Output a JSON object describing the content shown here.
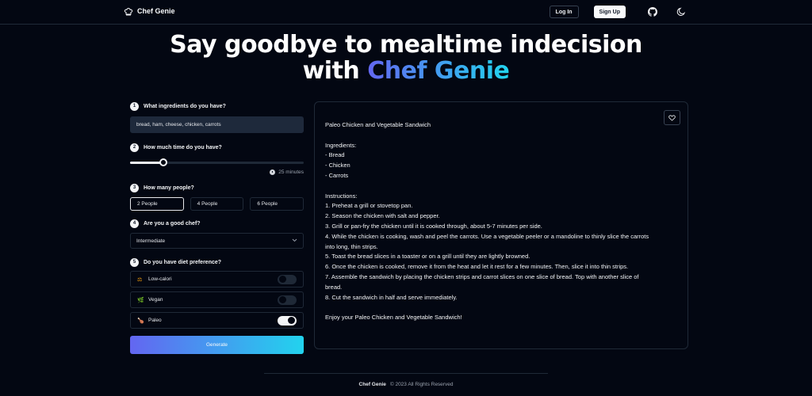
{
  "header": {
    "brand": "Chef Genie",
    "login_label": "Log In",
    "signup_label": "Sign Up",
    "icons": [
      "chef-hat-icon",
      "github-icon",
      "moon-icon"
    ]
  },
  "hero": {
    "line1": "Say goodbye to mealtime indecision",
    "line2_prefix": "with ",
    "line2_highlight": "Chef Genie"
  },
  "form": {
    "steps": [
      {
        "num": "1",
        "label": "What ingredients do you have?"
      },
      {
        "num": "2",
        "label": "How much time do you have?"
      },
      {
        "num": "3",
        "label": "How many people?"
      },
      {
        "num": "4",
        "label": "Are you a good chef?"
      },
      {
        "num": "5",
        "label": "Do you have diet preference?"
      }
    ],
    "ingredients_value": "bread, ham, cheese, chicken, carrots",
    "time_fraction": 0.19,
    "time_label": "25 minutes",
    "people_options": [
      "2 People",
      "4 People",
      "6 People"
    ],
    "people_selected": "2 People",
    "chef_level": "Intermediate",
    "diets": [
      {
        "emoji": "⚖",
        "label": "Low-calori",
        "on": false
      },
      {
        "emoji": "🌿",
        "label": "Vegan",
        "on": false
      },
      {
        "emoji": "🍗",
        "label": "Paleo",
        "on": true
      }
    ],
    "generate_label": "Generate"
  },
  "recipe": {
    "title": "Paleo Chicken and Vegetable Sandwich",
    "ingredients_heading": "Ingredients:",
    "ingredients": [
      "- Bread",
      "- Chicken",
      "- Carrots"
    ],
    "instructions_heading": "Instructions:",
    "instructions": [
      "1. Preheat a grill or stovetop pan.",
      "2. Season the chicken with salt and pepper.",
      "3. Grill or pan-fry the chicken until it is cooked through, about 5-7 minutes per side.",
      "4. While the chicken is cooking, wash and peel the carrots. Use a vegetable peeler or a mandoline to thinly slice the carrots into long, thin strips.",
      "5. Toast the bread slices in a toaster or on a grill until they are lightly browned.",
      "6. Once the chicken is cooked, remove it from the heat and let it rest for a few minutes. Then, slice it into thin strips.",
      "7. Assemble the sandwich by placing the chicken strips and carrot slices on one slice of bread. Top with another slice of bread.",
      "8. Cut the sandwich in half and serve immediately."
    ],
    "closing": "Enjoy your Paleo Chicken and Vegetable Sandwich!"
  },
  "footer": {
    "brand": "Chef Genie",
    "copyright": "© 2023 All Rights Reserved"
  },
  "colors": {
    "background": "#030712",
    "gradient_start": "#6366f1",
    "gradient_end": "#22d3ee"
  }
}
